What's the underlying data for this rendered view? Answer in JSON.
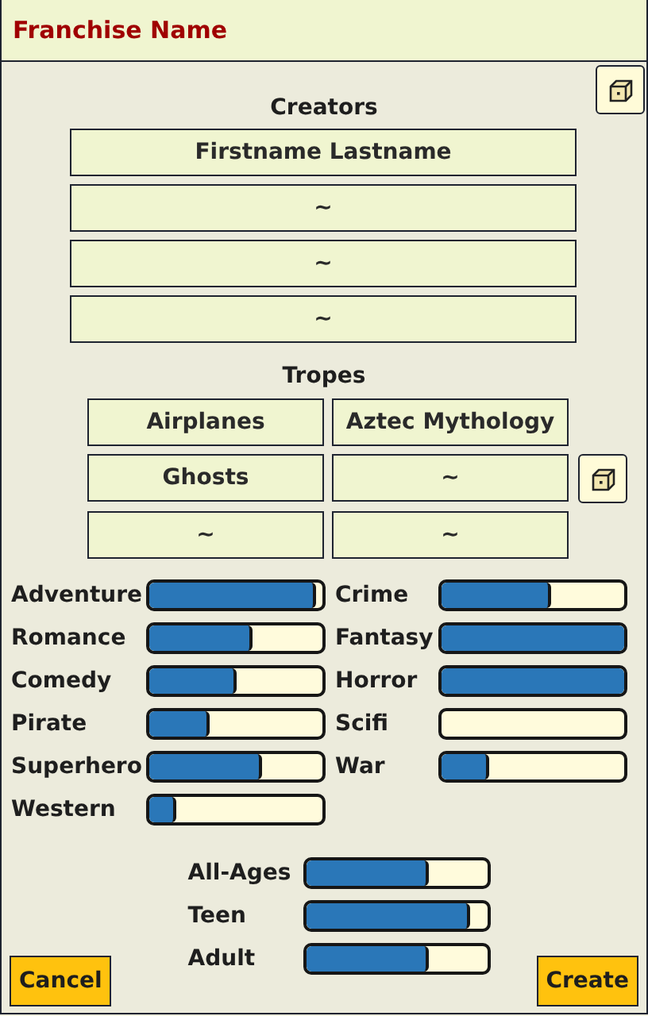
{
  "title": "Franchise Name",
  "creators": {
    "label": "Creators",
    "names": [
      "Firstname Lastname",
      "~",
      "~",
      "~"
    ]
  },
  "tropes": {
    "label": "Tropes",
    "items": [
      "Airplanes",
      "Aztec Mythology",
      "Ghosts",
      "~",
      "~",
      "~"
    ]
  },
  "genres": [
    {
      "name": "Adventure",
      "level": 0.96
    },
    {
      "name": "Crime",
      "level": 0.6
    },
    {
      "name": "Romance",
      "level": 0.6
    },
    {
      "name": "Fantasy",
      "level": 1
    },
    {
      "name": "Comedy",
      "level": 0.5
    },
    {
      "name": "Horror",
      "level": 1
    },
    {
      "name": "Pirate",
      "level": 0.35
    },
    {
      "name": "Scifi"
    },
    {
      "name": "Superhero",
      "level": 0.65
    },
    {
      "name": "War",
      "level": 0.26
    },
    {
      "name": "Western",
      "level": 0.16
    }
  ],
  "audiences": [
    {
      "name": "All-Ages",
      "level": 0.67
    },
    {
      "name": "Teen",
      "level": 0.9
    },
    {
      "name": "Adult",
      "level": 0.67
    }
  ],
  "buttons": {
    "cancel": "Cancel",
    "create": "Create"
  }
}
